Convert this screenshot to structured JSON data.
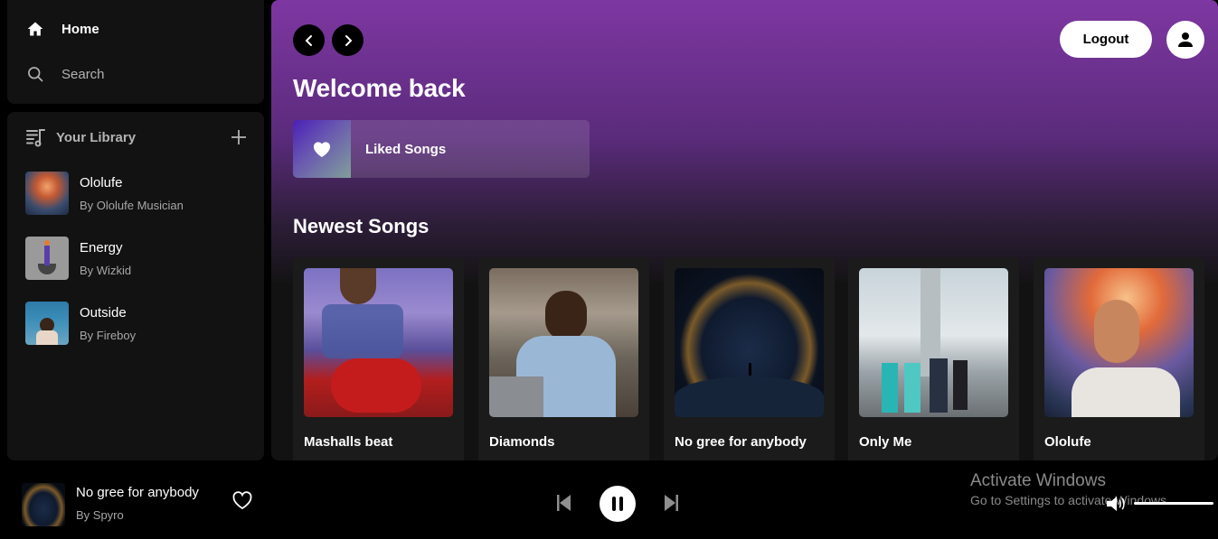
{
  "sidebar": {
    "nav": [
      {
        "label": "Home",
        "icon": "home-icon"
      },
      {
        "label": "Search",
        "icon": "search-icon"
      }
    ],
    "library": {
      "title": "Your Library",
      "icon": "library-icon",
      "add_icon": "plus-icon",
      "items": [
        {
          "title": "Ololufe",
          "subtitle": "By Ololufe Musician",
          "art": "headphones-man-cosmic"
        },
        {
          "title": "Energy",
          "subtitle": "By Wizkid",
          "art": "dancer-grey"
        },
        {
          "title": "Outside",
          "subtitle": "By Fireboy",
          "art": "fireboy-cover"
        }
      ]
    }
  },
  "main": {
    "header": {
      "back_icon": "chevron-left-icon",
      "forward_icon": "chevron-right-icon",
      "logout_label": "Logout",
      "profile_icon": "user-icon"
    },
    "welcome": "Welcome back",
    "liked_songs": {
      "label": "Liked Songs",
      "icon": "heart-icon"
    },
    "newest_title": "Newest Songs",
    "songs": [
      {
        "title": "Mashalls beat",
        "art": "woman-chair-purple"
      },
      {
        "title": "Diamonds",
        "art": "man-laptop"
      },
      {
        "title": "No gree for anybody",
        "art": "cosmic-ring"
      },
      {
        "title": "Only Me",
        "art": "bridge-runners"
      },
      {
        "title": "Ololufe",
        "art": "headphones-man-cosmic"
      }
    ]
  },
  "player": {
    "now_playing": {
      "title": "No gree for anybody",
      "artist": "By Spyro",
      "art": "cosmic-ring"
    },
    "controls": {
      "prev_icon": "skip-previous-icon",
      "play_state": "playing",
      "pause_icon": "pause-icon",
      "next_icon": "skip-next-icon"
    },
    "volume": {
      "level": 1.0,
      "icon": "volume-icon"
    }
  },
  "os_overlay": {
    "activate_title": "Activate Windows",
    "activate_sub": "Go to Settings to activate Windows."
  }
}
